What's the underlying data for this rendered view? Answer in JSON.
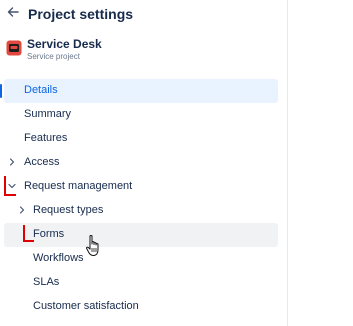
{
  "header": {
    "title": "Project settings"
  },
  "project": {
    "name": "Service Desk",
    "type": "Service project"
  },
  "nav": {
    "details": "Details",
    "summary": "Summary",
    "features": "Features",
    "access": "Access",
    "request_management": "Request management",
    "request_types": "Request types",
    "forms": "Forms",
    "workflows": "Workflows",
    "slas": "SLAs",
    "customer_satisfaction": "Customer satisfaction"
  },
  "colors": {
    "selected_bg": "#e9f2ff",
    "selected_text": "#0c66e4",
    "hover_bg": "#f1f2f4",
    "annotation_red": "#e00000",
    "project_icon": "#e2483d"
  },
  "icons": {
    "back": "arrow-left-icon",
    "project": "service-desk-project-icon",
    "expand": "chevron-right-icon",
    "collapse": "chevron-down-icon",
    "cursor": "hand-pointer-cursor-icon"
  }
}
